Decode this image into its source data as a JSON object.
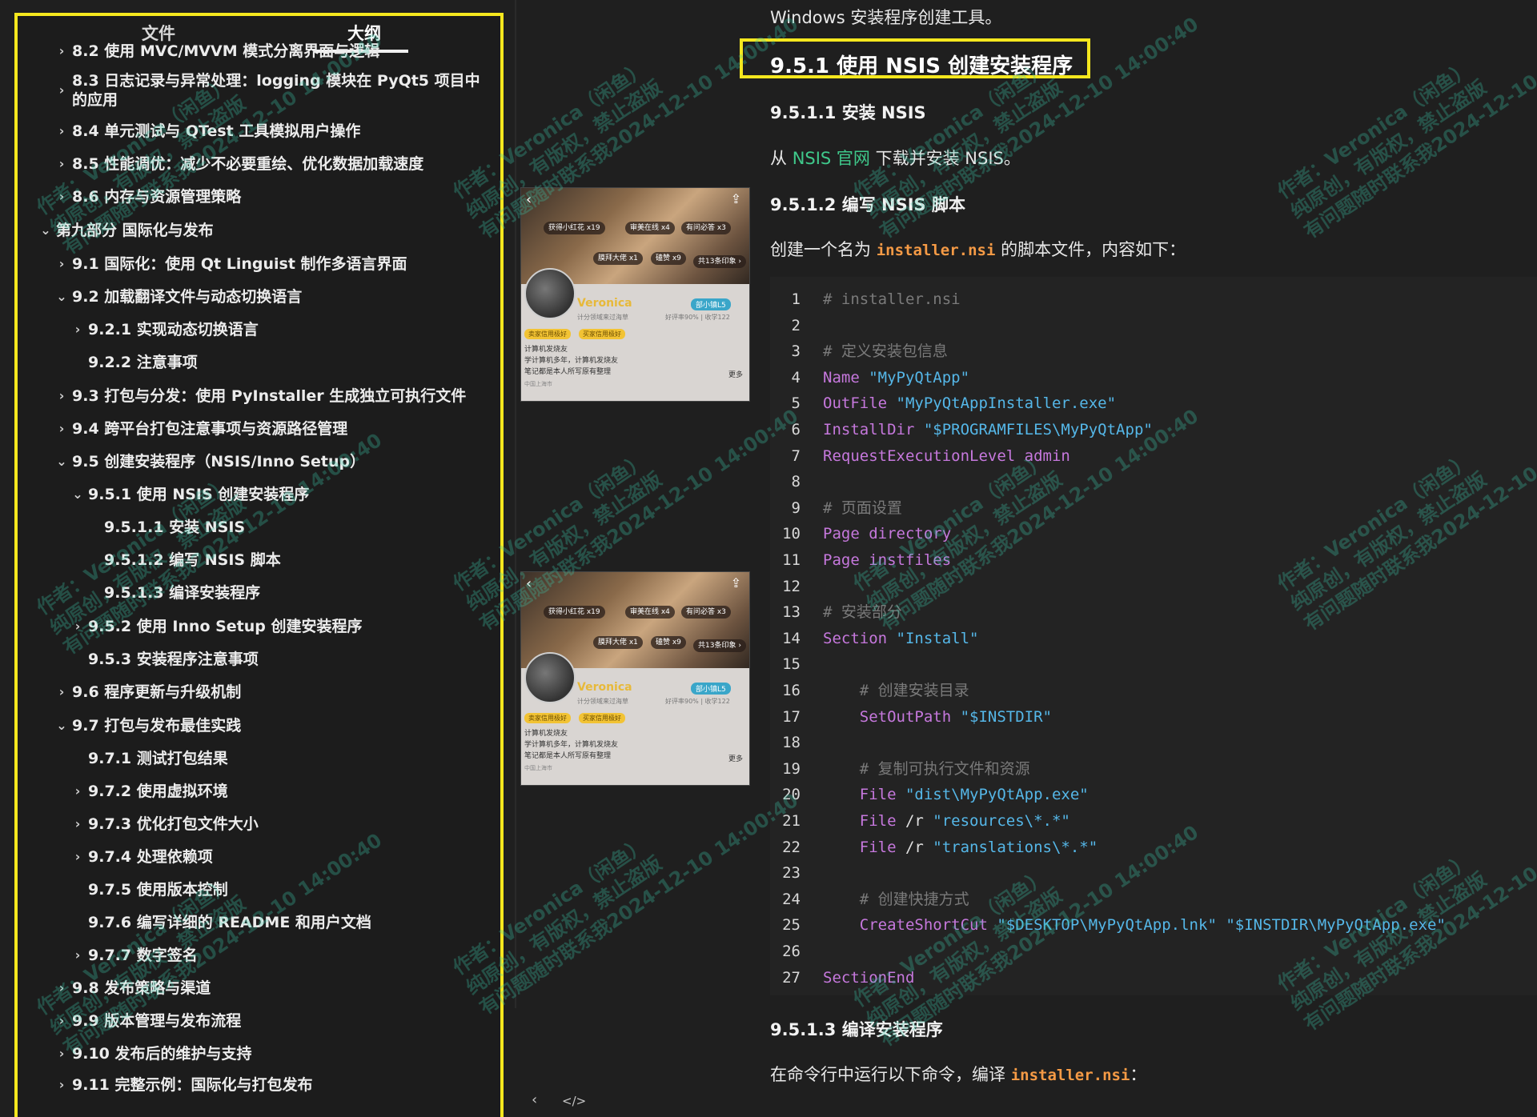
{
  "sidebar": {
    "tabs": [
      "文件",
      "大纲"
    ],
    "active_tab": "大纲",
    "items": [
      {
        "label": "8.2 使用 MVC/MVVM 模式分离界面与逻辑",
        "level": 1,
        "chevron": "›"
      },
      {
        "label": "8.3 日志记录与异常处理：logging 模块在 PyQt5 项目中的应用",
        "level": 1,
        "chevron": "›"
      },
      {
        "label": "8.4 单元测试与 QTest 工具模拟用户操作",
        "level": 1,
        "chevron": "›"
      },
      {
        "label": "8.5 性能调优：减少不必要重绘、优化数据加载速度",
        "level": 1,
        "chevron": "›"
      },
      {
        "label": "8.6 内存与资源管理策略",
        "level": 1,
        "chevron": "›"
      },
      {
        "label": "第九部分 国际化与发布",
        "level": 0,
        "chevron": "⌄"
      },
      {
        "label": "9.1 国际化：使用 Qt Linguist 制作多语言界面",
        "level": 1,
        "chevron": "›"
      },
      {
        "label": "9.2 加载翻译文件与动态切换语言",
        "level": 1,
        "chevron": "⌄"
      },
      {
        "label": "9.2.1 实现动态切换语言",
        "level": 2,
        "chevron": "›"
      },
      {
        "label": "9.2.2 注意事项",
        "level": 2,
        "chevron": ""
      },
      {
        "label": "9.3 打包与分发：使用 PyInstaller 生成独立可执行文件",
        "level": 1,
        "chevron": "›"
      },
      {
        "label": "9.4 跨平台打包注意事项与资源路径管理",
        "level": 1,
        "chevron": "›"
      },
      {
        "label": "9.5 创建安装程序（NSIS/Inno Setup）",
        "level": 1,
        "chevron": "⌄"
      },
      {
        "label": "9.5.1 使用 NSIS 创建安装程序",
        "level": 2,
        "chevron": "⌄"
      },
      {
        "label": "9.5.1.1 安装 NSIS",
        "level": 3,
        "chevron": ""
      },
      {
        "label": "9.5.1.2 编写 NSIS 脚本",
        "level": 3,
        "chevron": ""
      },
      {
        "label": "9.5.1.3 编译安装程序",
        "level": 3,
        "chevron": ""
      },
      {
        "label": "9.5.2 使用 Inno Setup 创建安装程序",
        "level": 2,
        "chevron": "›"
      },
      {
        "label": "9.5.3 安装程序注意事项",
        "level": 2,
        "chevron": ""
      },
      {
        "label": "9.6 程序更新与升级机制",
        "level": 1,
        "chevron": "›"
      },
      {
        "label": "9.7 打包与发布最佳实践",
        "level": 1,
        "chevron": "⌄"
      },
      {
        "label": "9.7.1 测试打包结果",
        "level": 2,
        "chevron": ""
      },
      {
        "label": "9.7.2 使用虚拟环境",
        "level": 2,
        "chevron": "›"
      },
      {
        "label": "9.7.3 优化打包文件大小",
        "level": 2,
        "chevron": "›"
      },
      {
        "label": "9.7.4 处理依赖项",
        "level": 2,
        "chevron": "›"
      },
      {
        "label": "9.7.5 使用版本控制",
        "level": 2,
        "chevron": ""
      },
      {
        "label": "9.7.6 编写详细的 README 和用户文档",
        "level": 2,
        "chevron": ""
      },
      {
        "label": "9.7.7 数字签名",
        "level": 2,
        "chevron": "›"
      },
      {
        "label": "9.8 发布策略与渠道",
        "level": 1,
        "chevron": "›"
      },
      {
        "label": "9.9 版本管理与发布流程",
        "level": 1,
        "chevron": "›"
      },
      {
        "label": "9.10 发布后的维护与支持",
        "level": 1,
        "chevron": "›"
      },
      {
        "label": "9.11 完整示例：国际化与打包发布",
        "level": 1,
        "chevron": "›"
      }
    ]
  },
  "thumbnails": {
    "badges": [
      "获得小红花 x19",
      "审美在线 x4",
      "有问必答 x3",
      "膜拜大佬 x1",
      "磕赞 x9",
      "共13条印象 ›"
    ],
    "username": "Veronica",
    "level_badge": "部小镇L5",
    "subtitle": "计分领域来过海草",
    "rate": "好评率90% | 收学122",
    "tags": [
      "卖家信用极好",
      "买家信用极好"
    ],
    "lines": [
      "计算机发烧友",
      "学计算机多年，计算机发烧友",
      "笔记都是本人所写原有整理"
    ],
    "location": "中国上海市",
    "more": "更多"
  },
  "mid_controls": {
    "back": "‹",
    "code": "</>"
  },
  "doc": {
    "intro": "Windows 安装程序创建工具。",
    "h3": "9.5.1 使用 NSIS 创建安装程序",
    "h4_1": "9.5.1.1 安装 NSIS",
    "p1_pre": "从 ",
    "p1_link": "NSIS 官网",
    "p1_post": " 下载并安装 NSIS。",
    "h4_2": "9.5.1.2 编写 NSIS 脚本",
    "p2_pre": "创建一个名为 ",
    "p2_code": "installer.nsi",
    "p2_post": " 的脚本文件，内容如下：",
    "code": [
      [
        {
          "t": "# installer.nsi",
          "c": "com"
        }
      ],
      [],
      [
        {
          "t": "# 定义安装包信息",
          "c": "com"
        }
      ],
      [
        {
          "t": "Name ",
          "c": "kw"
        },
        {
          "t": "\"MyPyQtApp\"",
          "c": "str"
        }
      ],
      [
        {
          "t": "OutFile ",
          "c": "kw"
        },
        {
          "t": "\"MyPyQtAppInstaller.exe\"",
          "c": "str"
        }
      ],
      [
        {
          "t": "InstallDir ",
          "c": "kw"
        },
        {
          "t": "\"$PROGRAMFILES\\MyPyQtApp\"",
          "c": "str"
        }
      ],
      [
        {
          "t": "RequestExecutionLevel admin",
          "c": "kw"
        }
      ],
      [],
      [
        {
          "t": "# 页面设置",
          "c": "com"
        }
      ],
      [
        {
          "t": "Page directory",
          "c": "kw"
        }
      ],
      [
        {
          "t": "Page instfiles",
          "c": "kw"
        }
      ],
      [],
      [
        {
          "t": "# 安装部分",
          "c": "com"
        }
      ],
      [
        {
          "t": "Section ",
          "c": "kw"
        },
        {
          "t": "\"Install\"",
          "c": "str"
        }
      ],
      [],
      [
        {
          "t": "    # 创建安装目录",
          "c": "com"
        }
      ],
      [
        {
          "t": "    SetOutPath ",
          "c": "kw"
        },
        {
          "t": "\"$INSTDIR\"",
          "c": "str"
        }
      ],
      [],
      [
        {
          "t": "    # 复制可执行文件和资源",
          "c": "com"
        }
      ],
      [
        {
          "t": "    File ",
          "c": "kw"
        },
        {
          "t": "\"dist\\MyPyQtApp.exe\"",
          "c": "str"
        }
      ],
      [
        {
          "t": "    File ",
          "c": "kw"
        },
        {
          "t": "/r ",
          "c": "plain"
        },
        {
          "t": "\"resources\\*.*\"",
          "c": "str"
        }
      ],
      [
        {
          "t": "    File ",
          "c": "kw"
        },
        {
          "t": "/r ",
          "c": "plain"
        },
        {
          "t": "\"translations\\*.*\"",
          "c": "str"
        }
      ],
      [],
      [
        {
          "t": "    # 创建快捷方式",
          "c": "com"
        }
      ],
      [
        {
          "t": "    CreateShortCut ",
          "c": "kw"
        },
        {
          "t": "\"$DESKTOP\\MyPyQtApp.lnk\" \"$INSTDIR\\MyPyQtApp.exe\"",
          "c": "str"
        }
      ],
      [],
      [
        {
          "t": "SectionEnd",
          "c": "kw"
        }
      ]
    ],
    "h4_3": "9.5.1.3 编译安装程序",
    "p3_pre": "在命令行中运行以下命令，编译 ",
    "p3_code": "installer.nsi",
    "p3_post": "："
  },
  "watermark": [
    "作者：Veronica（闲鱼）",
    "纯原创，有版权，禁止盗版",
    "有问题随时联系我2024-12-10 14:00:40"
  ],
  "colors": {
    "accent_yellow": "#f5e71e",
    "link_green": "#3fc98b",
    "code_keyword": "#c678dd",
    "code_string": "#55b7e8",
    "inline_code": "#f59a45"
  }
}
